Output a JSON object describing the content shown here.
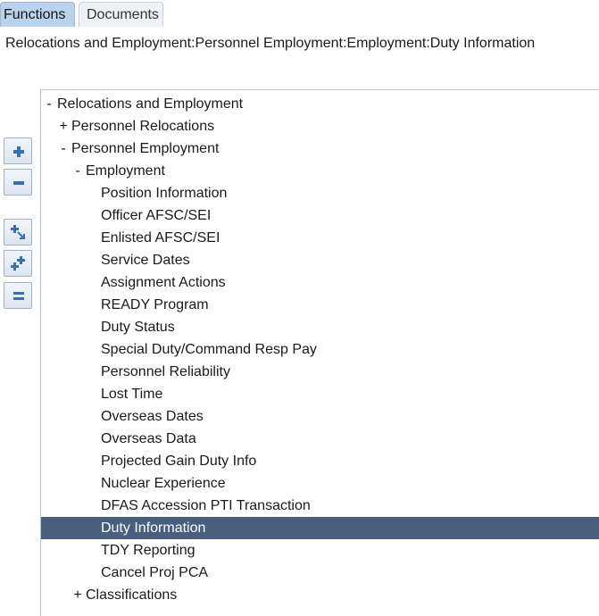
{
  "tabs": {
    "functions": "Functions",
    "documents": "Documents"
  },
  "breadcrumb": "Relocations and Employment:Personnel Employment:Employment:Duty Information",
  "toolbar": {
    "expand_icon": "plus-icon",
    "collapse_icon": "minus-icon",
    "focus_icon": "expand-focus-icon",
    "expand_all_icon": "expand-all-icon",
    "collapse_all_icon": "collapse-all-icon"
  },
  "tree": {
    "items": [
      {
        "toggle": "-",
        "label": "Relocations and Employment"
      },
      {
        "toggle": "+",
        "label": "Personnel Relocations"
      },
      {
        "toggle": "-",
        "label": "Personnel Employment"
      },
      {
        "toggle": "-",
        "label": "Employment"
      },
      {
        "toggle": "",
        "label": "Position Information"
      },
      {
        "toggle": "",
        "label": "Officer AFSC/SEI"
      },
      {
        "toggle": "",
        "label": "Enlisted AFSC/SEI"
      },
      {
        "toggle": "",
        "label": "Service Dates"
      },
      {
        "toggle": "",
        "label": "Assignment Actions"
      },
      {
        "toggle": "",
        "label": "READY Program"
      },
      {
        "toggle": "",
        "label": "Duty Status"
      },
      {
        "toggle": "",
        "label": "Special Duty/Command Resp Pay"
      },
      {
        "toggle": "",
        "label": "Personnel Reliability"
      },
      {
        "toggle": "",
        "label": "Lost Time"
      },
      {
        "toggle": "",
        "label": "Overseas Dates"
      },
      {
        "toggle": "",
        "label": "Overseas Data"
      },
      {
        "toggle": "",
        "label": "Projected Gain Duty Info"
      },
      {
        "toggle": "",
        "label": "Nuclear Experience"
      },
      {
        "toggle": "",
        "label": "DFAS Accession PTI Transaction"
      },
      {
        "toggle": "",
        "label": "Duty Information"
      },
      {
        "toggle": "",
        "label": "TDY Reporting"
      },
      {
        "toggle": "",
        "label": "Cancel Proj PCA"
      },
      {
        "toggle": "+",
        "label": "Classifications"
      }
    ]
  },
  "colors": {
    "selected_row_bg": "#485f80",
    "active_tab_bg": "#b9d3ee"
  }
}
